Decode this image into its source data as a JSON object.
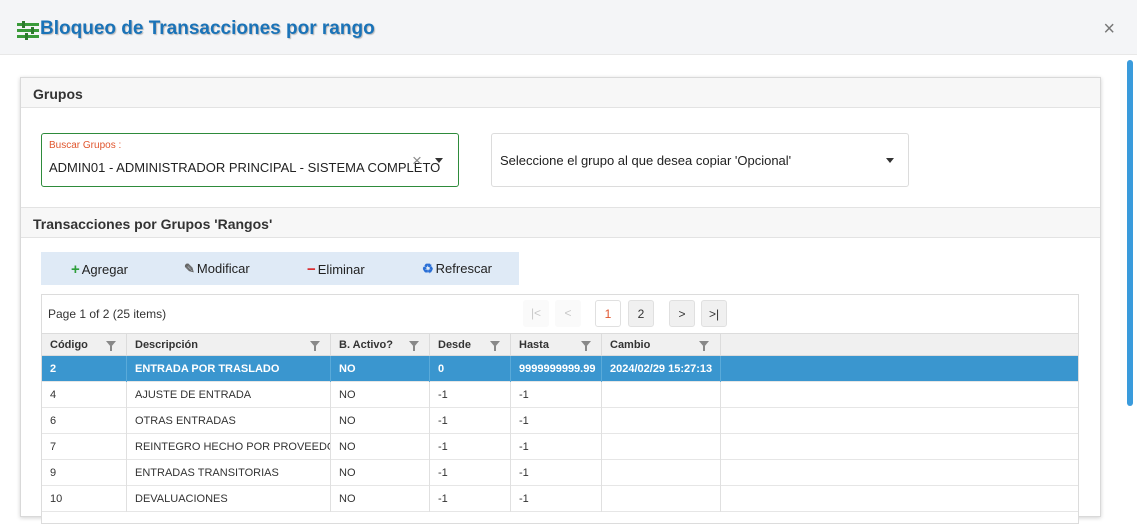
{
  "dialog": {
    "title": "Bloqueo de Transacciones por rango",
    "close_glyph": "×"
  },
  "groups_panel": {
    "heading": "Grupos",
    "search_group": {
      "label": "Buscar Grupos :",
      "value": "ADMIN01 - ADMINISTRADOR PRINCIPAL - SISTEMA COMPLETO",
      "clear_glyph": "×"
    },
    "copy_group": {
      "placeholder": "Seleccione el grupo al que desea copiar 'Opcional'"
    }
  },
  "transactions_panel": {
    "heading": "Transacciones por Grupos 'Rangos'",
    "toolbar": {
      "add_label": "Agregar",
      "edit_label": "Modificar",
      "delete_label": "Eliminar",
      "refresh_label": "Refrescar"
    },
    "pager": {
      "info": "Page 1 of 2 (25 items)",
      "first_glyph": "|<",
      "prev_glyph": "<",
      "pages": [
        "1",
        "2"
      ],
      "next_glyph": ">",
      "last_glyph": ">|"
    },
    "columns": [
      "Código",
      "Descripción",
      "B. Activo?",
      "Desde",
      "Hasta",
      "Cambio"
    ],
    "rows": [
      {
        "codigo": "2",
        "descripcion": "ENTRADA POR TRASLADO",
        "activo": "NO",
        "desde": "0",
        "hasta": "9999999999.99",
        "cambio": "2024/02/29 15:27:13"
      },
      {
        "codigo": "4",
        "descripcion": "AJUSTE DE ENTRADA",
        "activo": "NO",
        "desde": "-1",
        "hasta": "-1",
        "cambio": ""
      },
      {
        "codigo": "6",
        "descripcion": "OTRAS ENTRADAS",
        "activo": "NO",
        "desde": "-1",
        "hasta": "-1",
        "cambio": ""
      },
      {
        "codigo": "7",
        "descripcion": "REINTEGRO HECHO POR PROVEEDOR",
        "activo": "NO",
        "desde": "-1",
        "hasta": "-1",
        "cambio": ""
      },
      {
        "codigo": "9",
        "descripcion": "ENTRADAS TRANSITORIAS",
        "activo": "NO",
        "desde": "-1",
        "hasta": "-1",
        "cambio": ""
      },
      {
        "codigo": "10",
        "descripcion": "DEVALUACIONES",
        "activo": "NO",
        "desde": "-1",
        "hasta": "-1",
        "cambio": ""
      }
    ],
    "selected_row": 0
  },
  "colors": {
    "title": "#1a73b8",
    "accent_selected": "#3a96cf",
    "field_border_active": "#2e8b3b",
    "label_orange": "#e0562e",
    "add_icon": "#2e9e3a",
    "delete_icon": "#d9252a",
    "refresh_icon": "#2a6fd6"
  },
  "icons": {
    "title": "sliders-icon",
    "add": "plus-icon",
    "edit": "pencil-icon",
    "delete": "minus-icon",
    "refresh": "recycle-icon"
  }
}
